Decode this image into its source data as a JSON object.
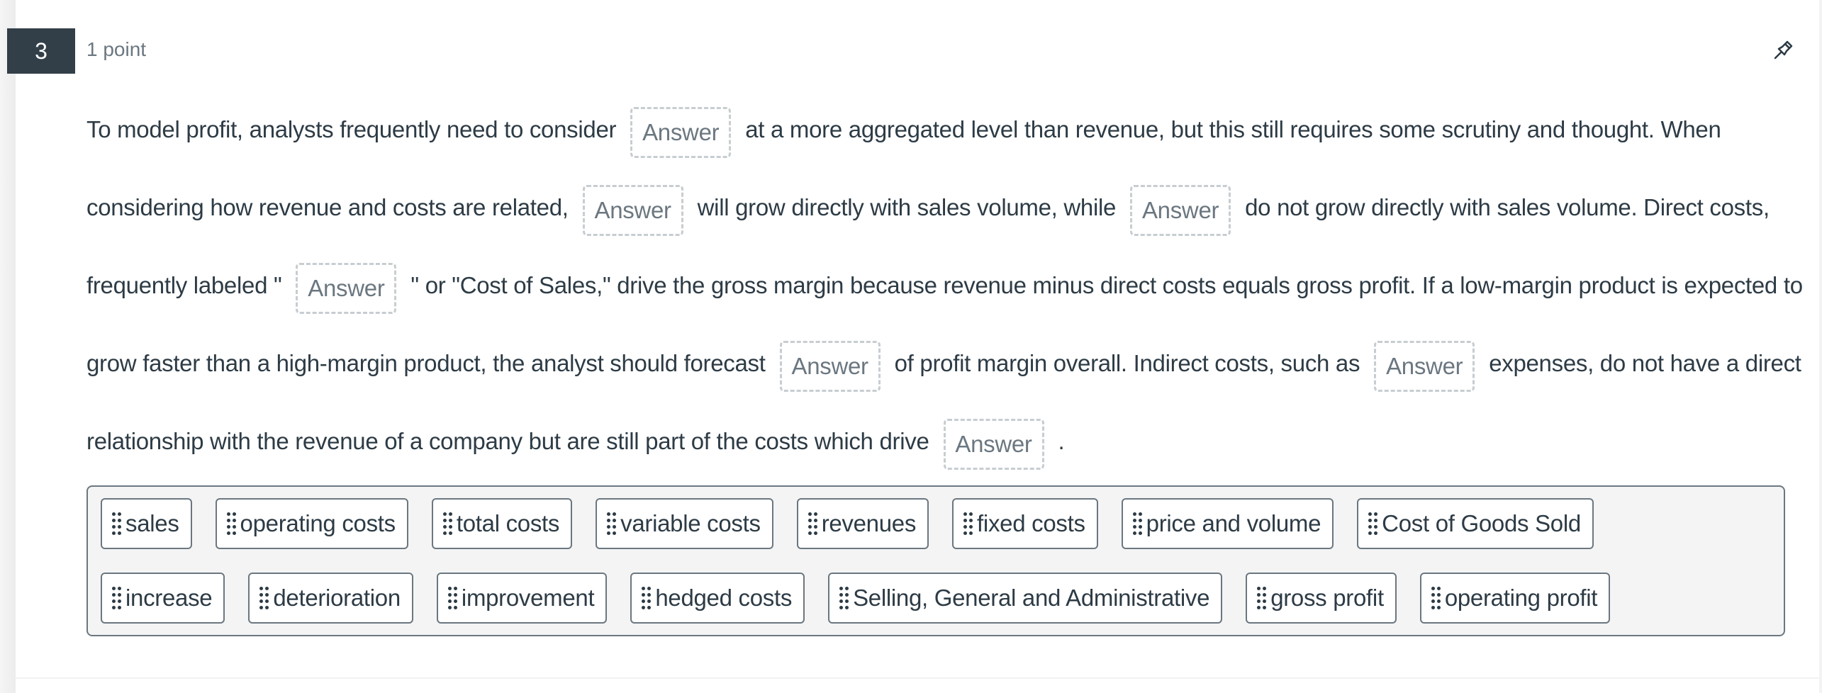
{
  "question": {
    "number": "3",
    "points": "1 point",
    "pin_icon": "pin-icon",
    "blank_placeholder": "Answer",
    "lines": [
      {
        "segments": [
          {
            "text": "To model profit, analysts frequently need to consider"
          },
          {
            "blank": true
          },
          {
            "text": "at a more aggregated level than revenue, but this still requires some scrutiny and thought. When"
          }
        ]
      },
      {
        "segments": [
          {
            "text": "considering how revenue and costs are related,"
          },
          {
            "blank": true
          },
          {
            "text": "will grow directly with sales volume, while"
          },
          {
            "blank": true
          },
          {
            "text": "do not grow directly with sales volume. Direct costs,"
          }
        ]
      },
      {
        "segments": [
          {
            "text": "frequently labeled \""
          },
          {
            "blank": true
          },
          {
            "text": "\" or \"Cost of Sales,\" drive the gross margin because revenue minus direct costs equals gross profit. If a low-margin product is expected to"
          }
        ]
      },
      {
        "segments": [
          {
            "text": "grow faster than a high-margin product, the analyst should forecast"
          },
          {
            "blank": true
          },
          {
            "text": "of profit margin overall. Indirect costs, such as"
          },
          {
            "blank": true
          },
          {
            "text": "expenses, do not have a direct"
          }
        ]
      },
      {
        "segments": [
          {
            "text": "relationship with the revenue of a company but are still part of the costs which drive"
          },
          {
            "blank": true
          },
          {
            "text": "."
          }
        ]
      }
    ]
  },
  "answer_bank": {
    "drag_icon": "drag-handle-icon",
    "rows": [
      [
        "sales",
        "operating costs",
        "total costs",
        "variable costs",
        "revenues",
        "fixed costs",
        "price and volume",
        "Cost of Goods Sold"
      ],
      [
        "increase",
        "deterioration",
        "improvement",
        "hedged costs",
        "Selling, General and Administrative",
        "gross profit",
        "operating profit"
      ]
    ]
  }
}
